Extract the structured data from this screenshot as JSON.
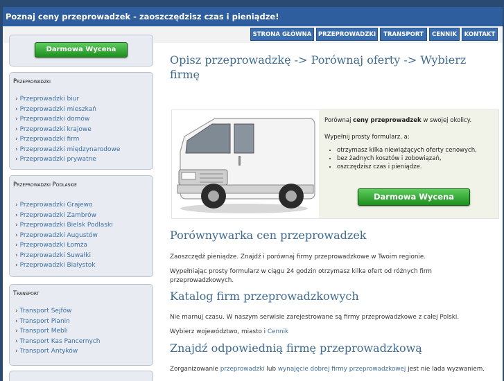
{
  "header": {
    "title": "Poznaj ceny przeprowadzek - zaoszczędzisz czas i pieniądze!"
  },
  "nav": [
    "STRONA GŁÓWNA",
    "PRZEPROWADZKI",
    "TRANSPORT",
    "CENNIK",
    "KONTAKT"
  ],
  "sidebar": {
    "button_label": "Darmowa Wycena",
    "sections": [
      {
        "title": "Przeprowadzki",
        "items": [
          "Przeprowadzki biur",
          "Przeprowadzki mieszkań",
          "Przeprowadzki domów",
          "Przeprowadzki krajowe",
          "Przeprowadzki firm",
          "Przeprowadzki międzynarodowe",
          "Przeprowadzki prywatne"
        ]
      },
      {
        "title": "Przeprowadzki Podlaskie",
        "items": [
          "Przeprowadzki Grajewo",
          "Przeprowadzki Zambrów",
          "Przeprowadzki Bielsk Podlaski",
          "Przeprowadzki Augustów",
          "Przeprowadzki Łomża",
          "Przeprowadzki Suwałki",
          "Przeprowadzki Białystok"
        ]
      },
      {
        "title": "Transport",
        "items": [
          "Transport Sejfów",
          "Transport Pianin",
          "Transport Mebli",
          "Transport Kas Pancernych",
          "Transport Antyków"
        ]
      }
    ]
  },
  "main": {
    "headline": "Opisz przeprowadzkę -> Porównaj oferty -> Wybierz firmę",
    "offer": {
      "line1_before": "Porównaj ",
      "line1_bold": "ceny przeprowadzek",
      "line1_after": " w swojej okolicy.",
      "line2": "Wypełnij prosty formularz, a:",
      "bullets": [
        "otrzymasz kilka niewiążących oferty cenowych,",
        "bez żadnych kosztów i zobowiązań,",
        "oszczędzisz czas i pieniądze."
      ],
      "button_label": "Darmowa Wycena"
    },
    "sections": [
      {
        "title": "Porównywarka cen przeprowadzek",
        "p1": "Zaoszczędź pieniądze. Znajdź i porównaj firmy przeprowadzkowe w Twoim regionie.",
        "p2": "Wypełniając prosty formularz w ciągu 24 godzin otrzymasz kilka ofert od różnych firm przeprowadzkowych."
      },
      {
        "title": "Katalog firm przeprowadzkowych",
        "p1": "Nie marnuj czasu. W naszym serwisie zarejestrowane są firmy przeprowadzkowe z całej Polski.",
        "p2_before": "Wybierz województwo, miasto i ",
        "p2_link": "Cennik"
      },
      {
        "title": "Znajdź odpowiednią firmę przeprowadzkową",
        "p1_a": "Zorganizowanie ",
        "p1_link1": "przeprowadzki",
        "p1_b": " lub ",
        "p1_link2": "wynajęcie dobrej firmy przeprowadzkowej",
        "p1_c": " jest nie lada wyzwaniem."
      }
    ]
  }
}
